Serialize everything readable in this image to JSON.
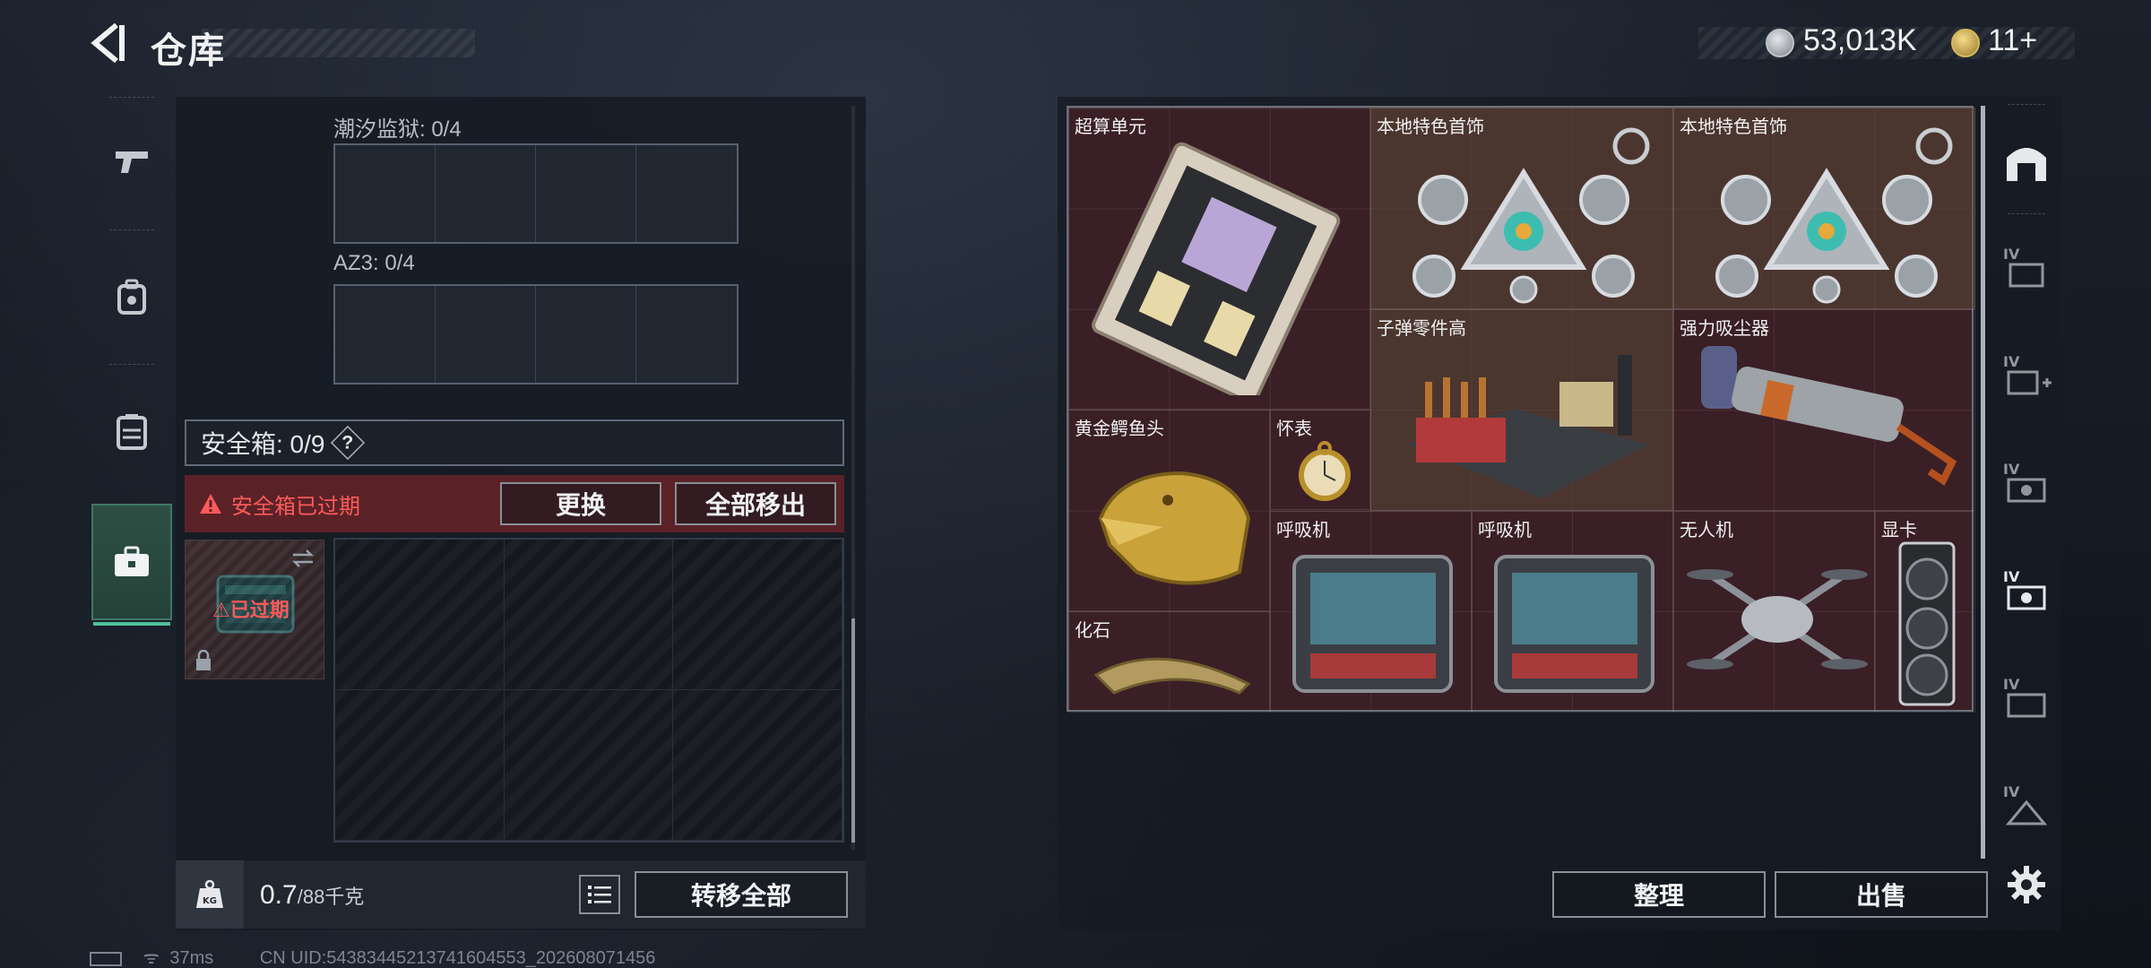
{
  "header": {
    "title": "仓库",
    "currency": [
      {
        "icon": "silver-coin-icon",
        "value": "53,013K"
      },
      {
        "icon": "gold-coin-icon",
        "value": "11+"
      }
    ]
  },
  "left_nav": [
    {
      "icon": "pistol-icon",
      "active": false
    },
    {
      "icon": "backpack-icon",
      "active": false
    },
    {
      "icon": "vest-icon",
      "active": false
    },
    {
      "icon": "briefcase-icon",
      "active": true
    }
  ],
  "containers": [
    {
      "label": "潮汐监狱: 0/4"
    },
    {
      "label": "AZ3: 0/4"
    }
  ],
  "safe_box": {
    "label": "安全箱: 0/9",
    "help": "?",
    "warning": "安全箱已过期",
    "replace_button": "更换",
    "remove_all_button": "全部移出",
    "thumb_label": "已过期"
  },
  "weight": {
    "current": "0.7",
    "max": "/88千克"
  },
  "transfer_all_button": "转移全部",
  "stash": {
    "items": [
      {
        "name": "超算单元"
      },
      {
        "name": "本地特色首饰"
      },
      {
        "name": "本地特色首饰"
      },
      {
        "name": "子弹零件高"
      },
      {
        "name": "强力吸尘器"
      },
      {
        "name": "黄金鳄鱼头"
      },
      {
        "name": "怀表"
      },
      {
        "name": "呼吸机"
      },
      {
        "name": "呼吸机"
      },
      {
        "name": "无人机"
      },
      {
        "name": "显卡"
      },
      {
        "name": "化石"
      }
    ],
    "sort_button": "整理",
    "sell_button": "出售"
  },
  "right_nav": [
    {
      "icon": "stash-icon"
    },
    {
      "icon": "stash-tab-iv-1-icon"
    },
    {
      "icon": "stash-tab-iv-add-icon"
    },
    {
      "icon": "stash-tab-iv-3-icon"
    },
    {
      "icon": "stash-tab-iv-4-icon"
    },
    {
      "icon": "stash-tab-iv-5-icon"
    },
    {
      "icon": "stash-tab-iv-6-icon"
    },
    {
      "icon": "settings-icon"
    }
  ],
  "status_bar": {
    "ping": "37ms",
    "uid": "CN UID:54383445213741604553_202608071456"
  }
}
